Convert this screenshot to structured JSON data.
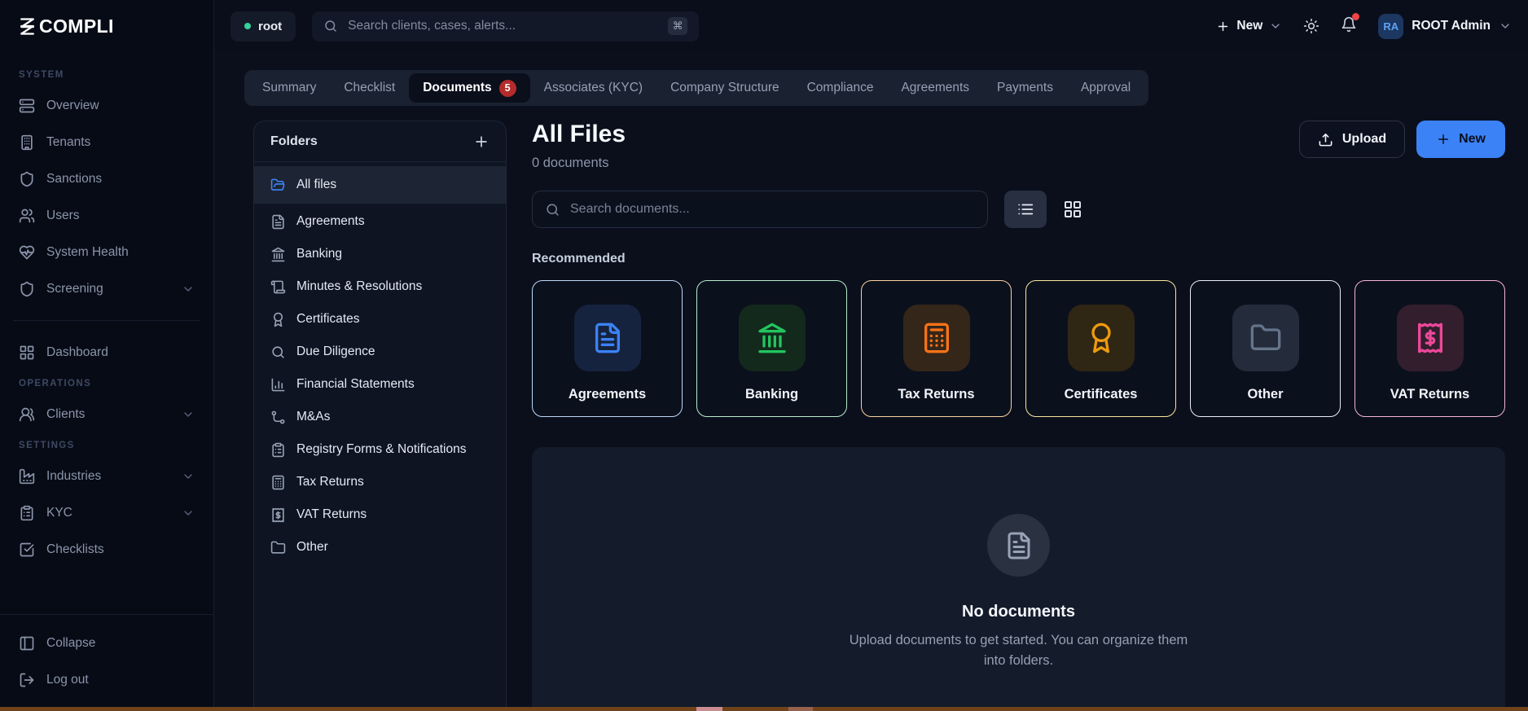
{
  "brand": {
    "logo_text": "COMPLI"
  },
  "topbar": {
    "workspace": "root",
    "search_placeholder": "Search clients, cases, alerts...",
    "shortcut_key": "⌘",
    "new_label": "New",
    "user_initials": "RA",
    "user_name": "ROOT Admin"
  },
  "sidebar": {
    "sections": [
      {
        "header": "SYSTEM",
        "items": [
          {
            "label": "Overview",
            "icon": "server-icon"
          },
          {
            "label": "Tenants",
            "icon": "building-icon"
          },
          {
            "label": "Sanctions",
            "icon": "shield-icon"
          },
          {
            "label": "Users",
            "icon": "users-icon"
          },
          {
            "label": "System Health",
            "icon": "heart-pulse-icon"
          },
          {
            "label": "Screening",
            "icon": "shield-icon",
            "expandable": true
          }
        ]
      },
      {
        "header": "",
        "items": [
          {
            "label": "Dashboard",
            "icon": "dashboard-grid-icon"
          }
        ]
      },
      {
        "header": "OPERATIONS",
        "items": [
          {
            "label": "Clients",
            "icon": "user-round-icon",
            "expandable": true
          }
        ]
      },
      {
        "header": "SETTINGS",
        "items": [
          {
            "label": "Industries",
            "icon": "factory-icon",
            "expandable": true
          },
          {
            "label": "KYC",
            "icon": "clipboard-icon",
            "expandable": true
          },
          {
            "label": "Checklists",
            "icon": "square-check-icon"
          }
        ]
      }
    ],
    "footer": {
      "collapse_label": "Collapse",
      "logout_label": "Log out"
    }
  },
  "tabs": {
    "items": [
      {
        "label": "Summary"
      },
      {
        "label": "Checklist"
      },
      {
        "label": "Documents",
        "badge": "5",
        "active": true
      },
      {
        "label": "Associates (KYC)"
      },
      {
        "label": "Company Structure"
      },
      {
        "label": "Compliance"
      },
      {
        "label": "Agreements"
      },
      {
        "label": "Payments"
      },
      {
        "label": "Approval"
      }
    ]
  },
  "folders": {
    "title": "Folders",
    "items": [
      {
        "label": "All files",
        "icon": "folder-open-icon",
        "active": true
      },
      {
        "label": "Agreements",
        "icon": "file-text-icon"
      },
      {
        "label": "Banking",
        "icon": "landmark-icon"
      },
      {
        "label": "Minutes & Resolutions",
        "icon": "scroll-icon"
      },
      {
        "label": "Certificates",
        "icon": "award-icon"
      },
      {
        "label": "Due Diligence",
        "icon": "search-icon"
      },
      {
        "label": "Financial Statements",
        "icon": "chart-column-icon"
      },
      {
        "label": "M&As",
        "icon": "route-icon"
      },
      {
        "label": "Registry Forms & Notifications",
        "icon": "clipboard-icon"
      },
      {
        "label": "Tax Returns",
        "icon": "calculator-icon"
      },
      {
        "label": "VAT Returns",
        "icon": "receipt-dollar-icon"
      },
      {
        "label": "Other",
        "icon": "folder-icon"
      }
    ]
  },
  "main": {
    "title": "All Files",
    "subtitle": "0 documents",
    "upload_label": "Upload",
    "new_label": "New",
    "search_placeholder": "Search documents...",
    "recommended_label": "Recommended",
    "cards": [
      {
        "label": "Agreements",
        "icon": "file-text-icon",
        "border_color": "#bdd8f9",
        "tile_bg": "#16233f",
        "icon_color": "#3b82f6"
      },
      {
        "label": "Banking",
        "icon": "landmark-icon",
        "border_color": "#b9edcc",
        "tile_bg": "#13291c",
        "icon_color": "#22c55e"
      },
      {
        "label": "Tax Returns",
        "icon": "calculator-icon",
        "border_color": "#fbd2a0",
        "tile_bg": "#342619",
        "icon_color": "#f97316"
      },
      {
        "label": "Certificates",
        "icon": "award-icon",
        "border_color": "#f9e89c",
        "tile_bg": "#302614",
        "icon_color": "#ec9b0f"
      },
      {
        "label": "Other",
        "icon": "folder-icon",
        "border_color": "#e9eef5",
        "tile_bg": "#242b3a",
        "icon_color": "#64748b"
      },
      {
        "label": "VAT Returns",
        "icon": "receipt-dollar-icon",
        "border_color": "#f5b5d8",
        "tile_bg": "#331e2e",
        "icon_color": "#ec4899"
      }
    ],
    "empty_state": {
      "title": "No documents",
      "line1": "Upload documents to get started. You can organize them",
      "line2": "into folders."
    }
  },
  "colors": {
    "accent_blue": "#3b82f6",
    "badge_red": "#b42b2b",
    "online_green": "#34d399",
    "notification_red": "#ef4444",
    "bottom_strip": "#70431a"
  }
}
